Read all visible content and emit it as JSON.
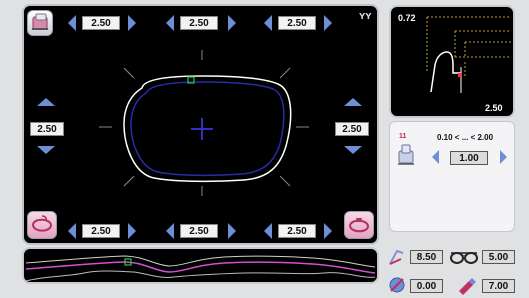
{
  "shape_panel": {
    "top_values": [
      "2.50",
      "2.50",
      "2.50"
    ],
    "bottom_values": [
      "2.50",
      "2.50",
      "2.50"
    ],
    "left_value": "2.50",
    "right_value": "2.50",
    "corner_glyph": "ʏʏ"
  },
  "profile_view": {
    "max_value": "0.72",
    "min_value": "2.50"
  },
  "thickness_control": {
    "label_number": "11",
    "range_text": "0.10 < ... < 2.00",
    "value": "1.00"
  },
  "bottom_values": {
    "bevel_value": "8.50",
    "frame_value": "5.00",
    "drill_value": "0.00",
    "pen_value": "7.00"
  },
  "colors": {
    "accent": "#6d8fd6",
    "lens_outline": "#ffffff",
    "lens_inner": "#2a2aa8",
    "marker": "#22cc44",
    "profile_line": "#d14fd1"
  },
  "icons": [
    "lens-tray-icon",
    "corner-menu-icon",
    "lens-shape-icon",
    "stamp-icon",
    "bevel-icon",
    "glasses-icon",
    "drill-icon",
    "pen-icon"
  ]
}
